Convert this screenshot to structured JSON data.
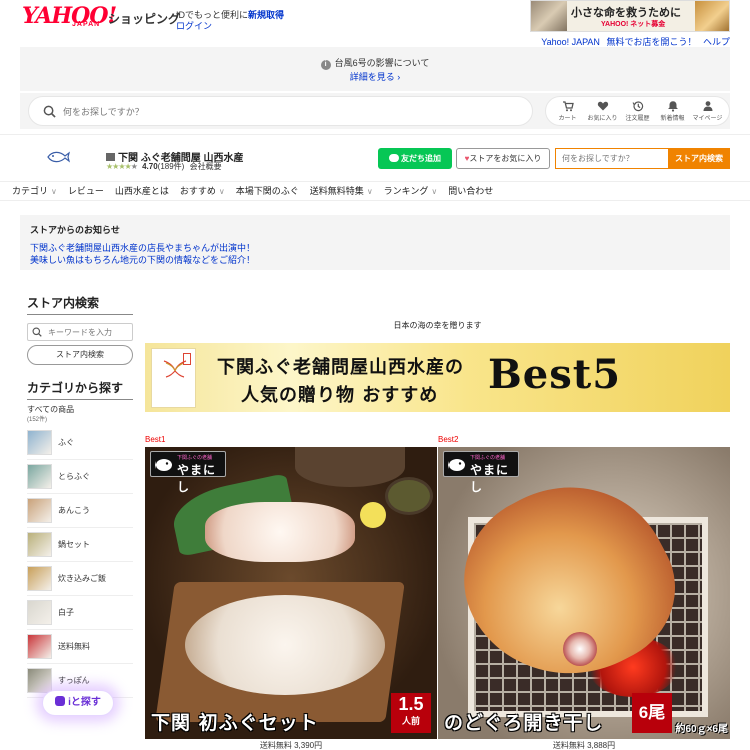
{
  "header": {
    "logo": "YAHOO!",
    "logo_sub": "JAPAN",
    "shopping_label": "ショッピング",
    "id_prompt": "IDでもっと便利に",
    "register_link": "新規取得",
    "login_link": "ログイン",
    "ad": {
      "title": "小さな命を救うために",
      "brand": "YAHOO! ネット募金"
    },
    "help_links": [
      "Yahoo! JAPAN",
      "無料でお店を開こう！",
      "ヘルプ"
    ]
  },
  "notice": {
    "text": "台風6号の影響について",
    "link": "詳細を見る ›"
  },
  "search": {
    "placeholder": "何をお探しですか？"
  },
  "icon_nav": [
    {
      "icon": "cart-icon",
      "label": "カート"
    },
    {
      "icon": "heart-icon",
      "label": "お気に入り"
    },
    {
      "icon": "history-icon",
      "label": "注文履歴"
    },
    {
      "icon": "bell-icon",
      "label": "新着情報"
    },
    {
      "icon": "user-icon",
      "label": "マイページ"
    }
  ],
  "store": {
    "name": "下関 ふぐ老舗問屋 山西水産",
    "stars": "★★★★",
    "star_half": "★",
    "rating": "4.70",
    "review_count": "(189件)",
    "company_link": "会社概要",
    "line_button": "友だち追加",
    "fav_button": "ストアをお気に入り",
    "search_placeholder": "何をお探しですか？",
    "search_button": "ストア内検索"
  },
  "store_nav": [
    {
      "label": "カテゴリ",
      "chevron": true
    },
    {
      "label": "レビュー",
      "chevron": false
    },
    {
      "label": "山西水産とは",
      "chevron": false
    },
    {
      "label": "おすすめ",
      "chevron": true
    },
    {
      "label": "本場下関のふぐ",
      "chevron": false
    },
    {
      "label": "送料無料特集",
      "chevron": true
    },
    {
      "label": "ランキング",
      "chevron": true
    },
    {
      "label": "問い合わせ",
      "chevron": false
    }
  ],
  "store_notice": {
    "title": "ストアからのお知らせ",
    "lines": [
      "下関ふぐ老舗問屋山西水産の店長やまちゃんが出演中！",
      "美味しい魚はもちろん地元の下関の情報などをご紹介！"
    ]
  },
  "sidebar": {
    "search_heading": "ストア内検索",
    "search_placeholder": "キーワードを入力",
    "search_button": "ストア内検索",
    "category_heading": "カテゴリから探す",
    "all_items": "すべての商品",
    "all_items_count": "(152件)",
    "categories": [
      {
        "label": "ふぐ",
        "color": "#8fb3cf"
      },
      {
        "label": "とらふぐ",
        "color": "#7aa7a0"
      },
      {
        "label": "あんこう",
        "color": "#c9a27a"
      },
      {
        "label": "鍋セット",
        "color": "#b9b07a"
      },
      {
        "label": "炊き込みご飯",
        "color": "#c8a05a"
      },
      {
        "label": "白子",
        "color": "#d9d7cf"
      },
      {
        "label": "送料無料",
        "color": "#c9363a"
      },
      {
        "label": "すっぽん",
        "color": "#8a8a7a"
      }
    ]
  },
  "main": {
    "tagline": "日本の海の幸を贈ります",
    "banner": {
      "line1": "下関ふぐ老舗問屋山西水産の",
      "line2": "人気の贈り物 おすすめ",
      "best": "Best5"
    },
    "products": [
      {
        "rank_label": "Best1",
        "badge": "やまにし",
        "badge_small": "下関ふぐの老舗",
        "title": "下関 初ふぐセット",
        "qty_big": "1.5",
        "qty_small": "人前",
        "price": "送料無料 3,390円"
      },
      {
        "rank_label": "Best2",
        "badge": "やまにし",
        "badge_small": "下関ふぐの老舗",
        "title": "のどぐろ開き干し",
        "qty_big": "6尾",
        "weight": "約60ｇ×6尾",
        "price": "送料無料 3,888円"
      }
    ]
  },
  "floating": {
    "label": "iと探す"
  }
}
